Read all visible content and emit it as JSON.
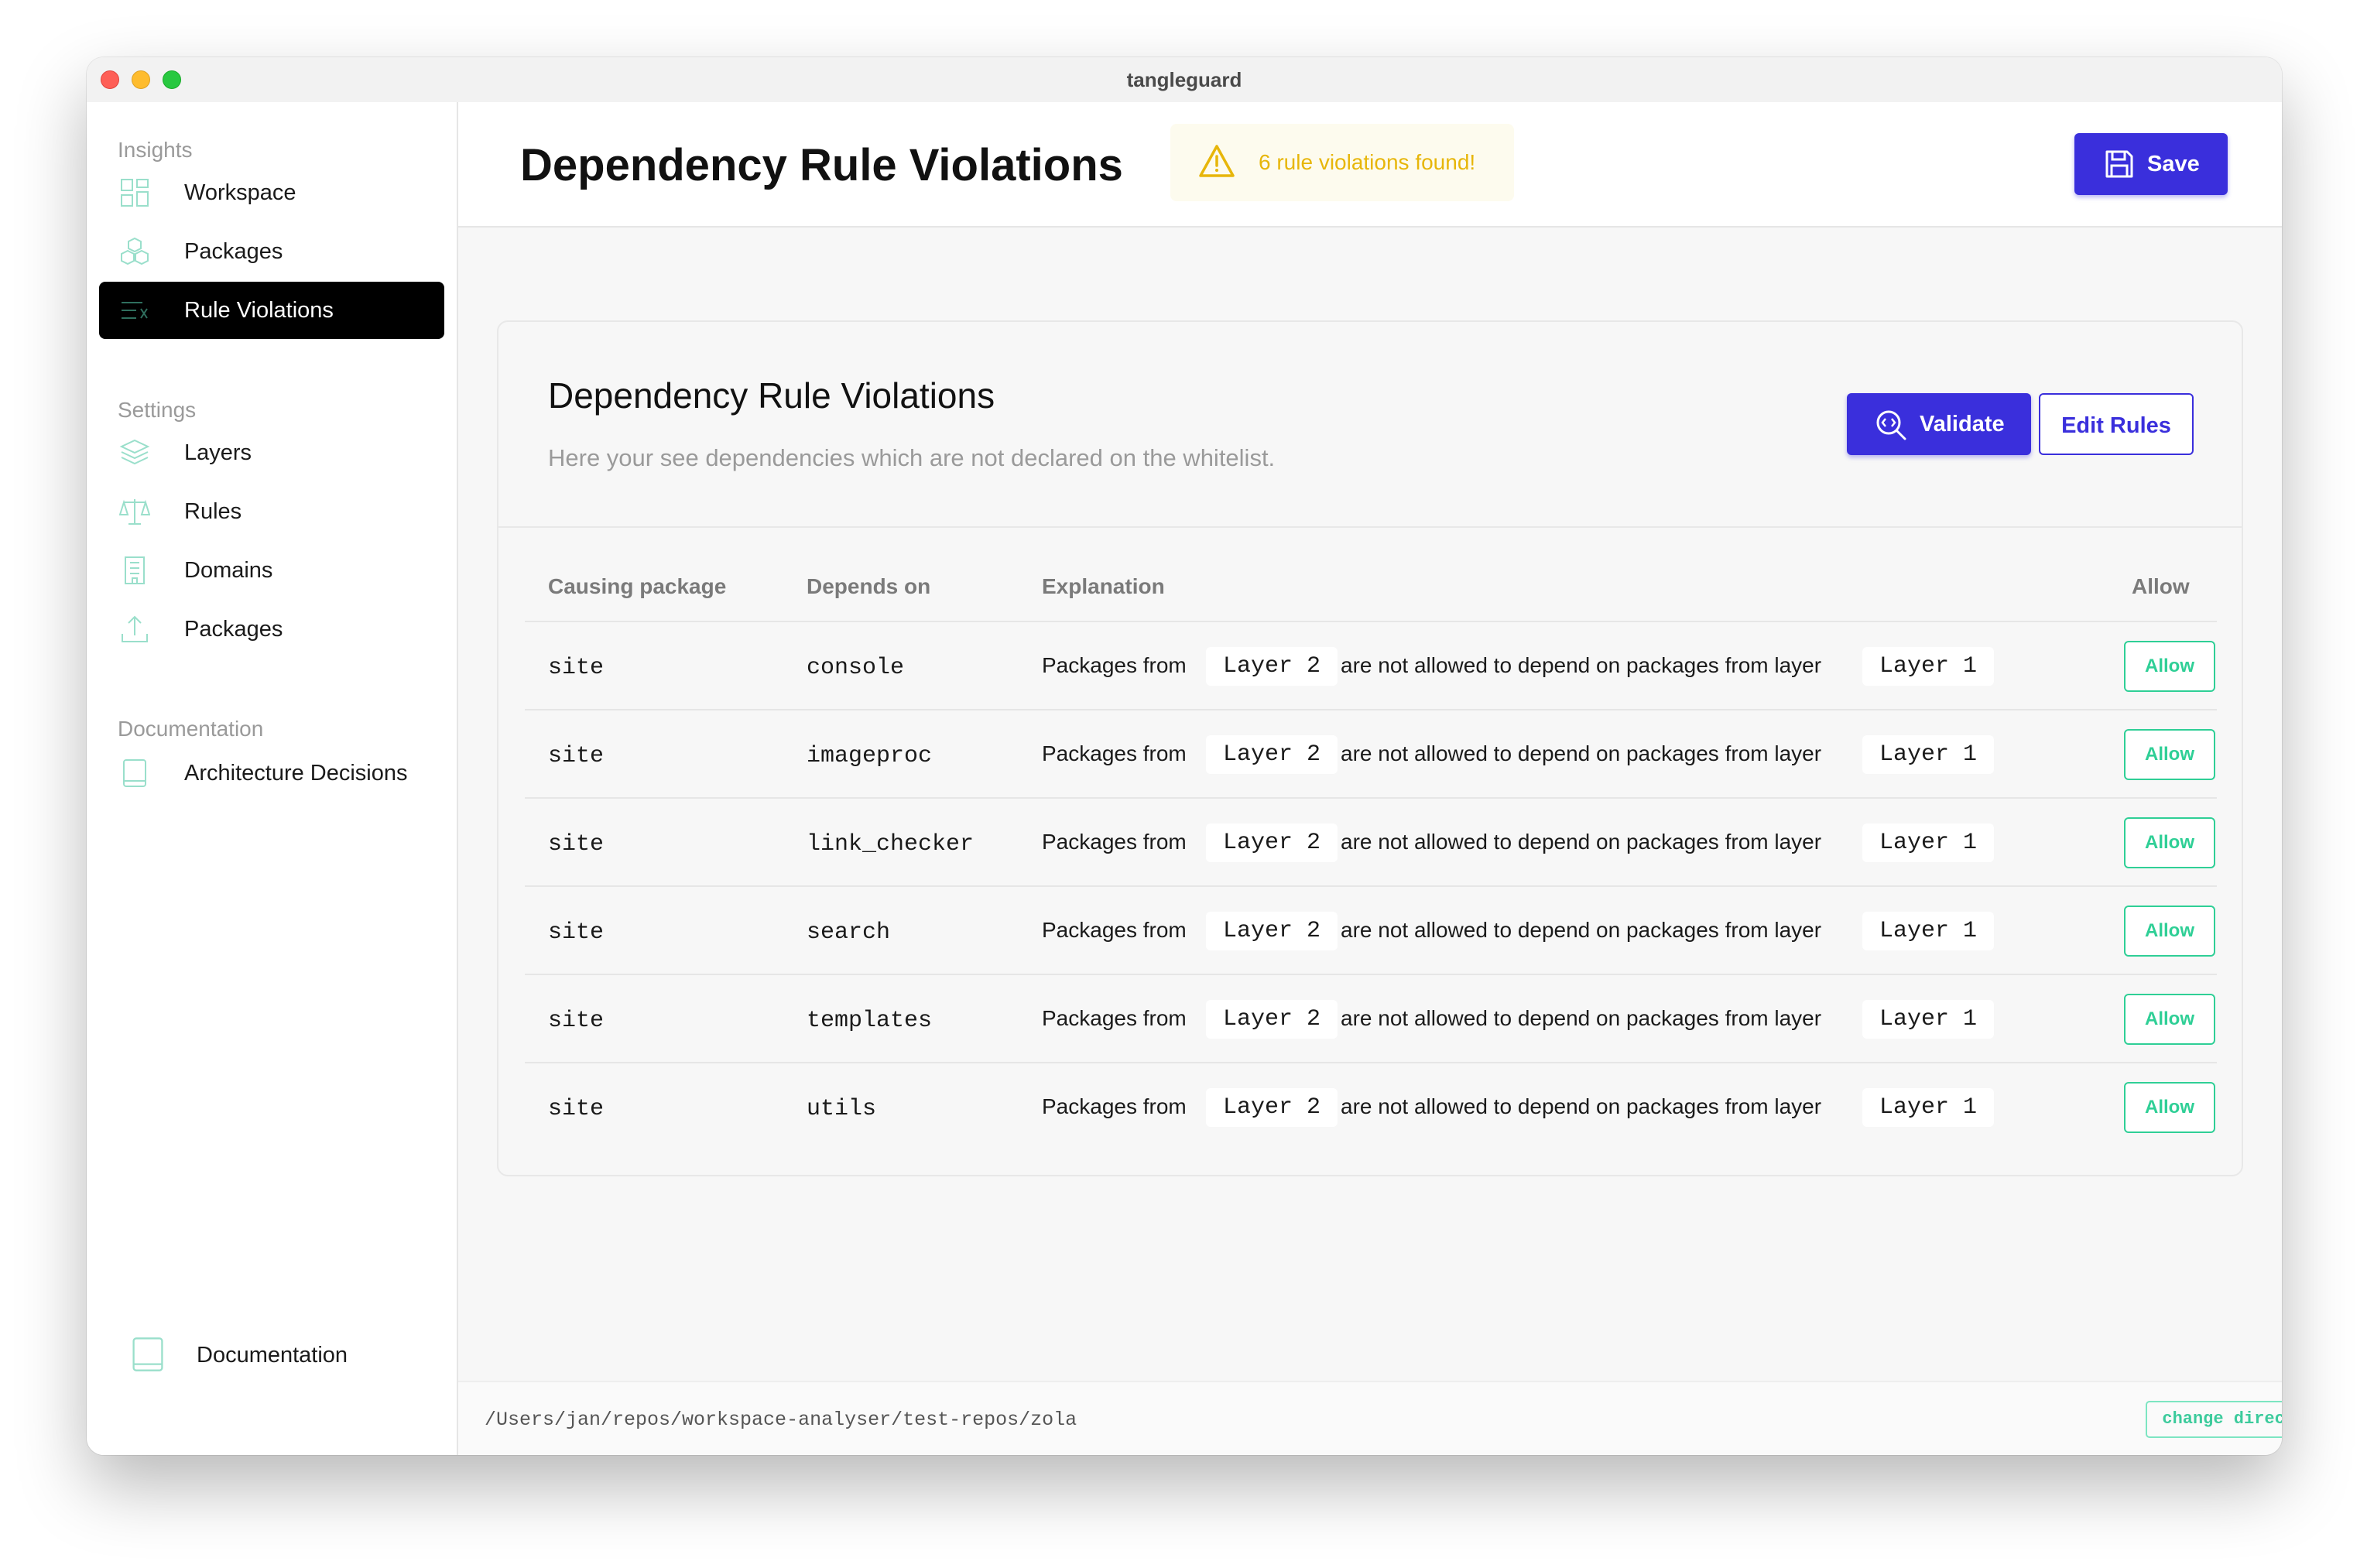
{
  "window": {
    "title": "tangleguard"
  },
  "sidebar": {
    "sections": [
      {
        "title": "Insights"
      },
      {
        "title": "Settings"
      },
      {
        "title": "Documentation"
      }
    ],
    "items": [
      {
        "label": "Workspace",
        "icon": "grid-icon"
      },
      {
        "label": "Packages",
        "icon": "cubes-icon"
      },
      {
        "label": "Rule Violations",
        "icon": "list-x-icon",
        "active": true
      },
      {
        "label": "Layers",
        "icon": "layers-icon"
      },
      {
        "label": "Rules",
        "icon": "scale-icon"
      },
      {
        "label": "Domains",
        "icon": "building-icon"
      },
      {
        "label": "Packages",
        "icon": "upload-icon"
      },
      {
        "label": "Architecture Decisions",
        "icon": "book-icon"
      }
    ],
    "footer_item": {
      "label": "Documentation",
      "icon": "book-icon"
    }
  },
  "header": {
    "title": "Dependency Rule Violations",
    "alert": "6 rule violations found!",
    "save_label": "Save"
  },
  "card": {
    "title": "Dependency Rule Violations",
    "subtitle": "Here your see dependencies which are not declared on the whitelist.",
    "validate_label": "Validate",
    "edit_rules_label": "Edit Rules"
  },
  "table": {
    "columns": [
      "Causing package",
      "Depends on",
      "Explanation",
      "Allow"
    ],
    "explanation_prefix": "Packages from",
    "explanation_middle": "are not allowed to depend on packages from layer",
    "rows": [
      {
        "causing": "site",
        "depends": "console",
        "from_layer": "Layer 2",
        "to_layer": "Layer 1",
        "action": "Allow"
      },
      {
        "causing": "site",
        "depends": "imageproc",
        "from_layer": "Layer 2",
        "to_layer": "Layer 1",
        "action": "Allow"
      },
      {
        "causing": "site",
        "depends": "link_checker",
        "from_layer": "Layer 2",
        "to_layer": "Layer 1",
        "action": "Allow"
      },
      {
        "causing": "site",
        "depends": "search",
        "from_layer": "Layer 2",
        "to_layer": "Layer 1",
        "action": "Allow"
      },
      {
        "causing": "site",
        "depends": "templates",
        "from_layer": "Layer 2",
        "to_layer": "Layer 1",
        "action": "Allow"
      },
      {
        "causing": "site",
        "depends": "utils",
        "from_layer": "Layer 2",
        "to_layer": "Layer 1",
        "action": "Allow"
      }
    ]
  },
  "footer": {
    "path": "/Users/jan/repos/workspace-analyser/test-repos/zola",
    "change_dir_label": "change directory"
  },
  "colors": {
    "accent": "#3a2fdc",
    "allow": "#2fcf96",
    "warning": "#e7b60a",
    "sidebar_icon": "#8fd9c4"
  }
}
